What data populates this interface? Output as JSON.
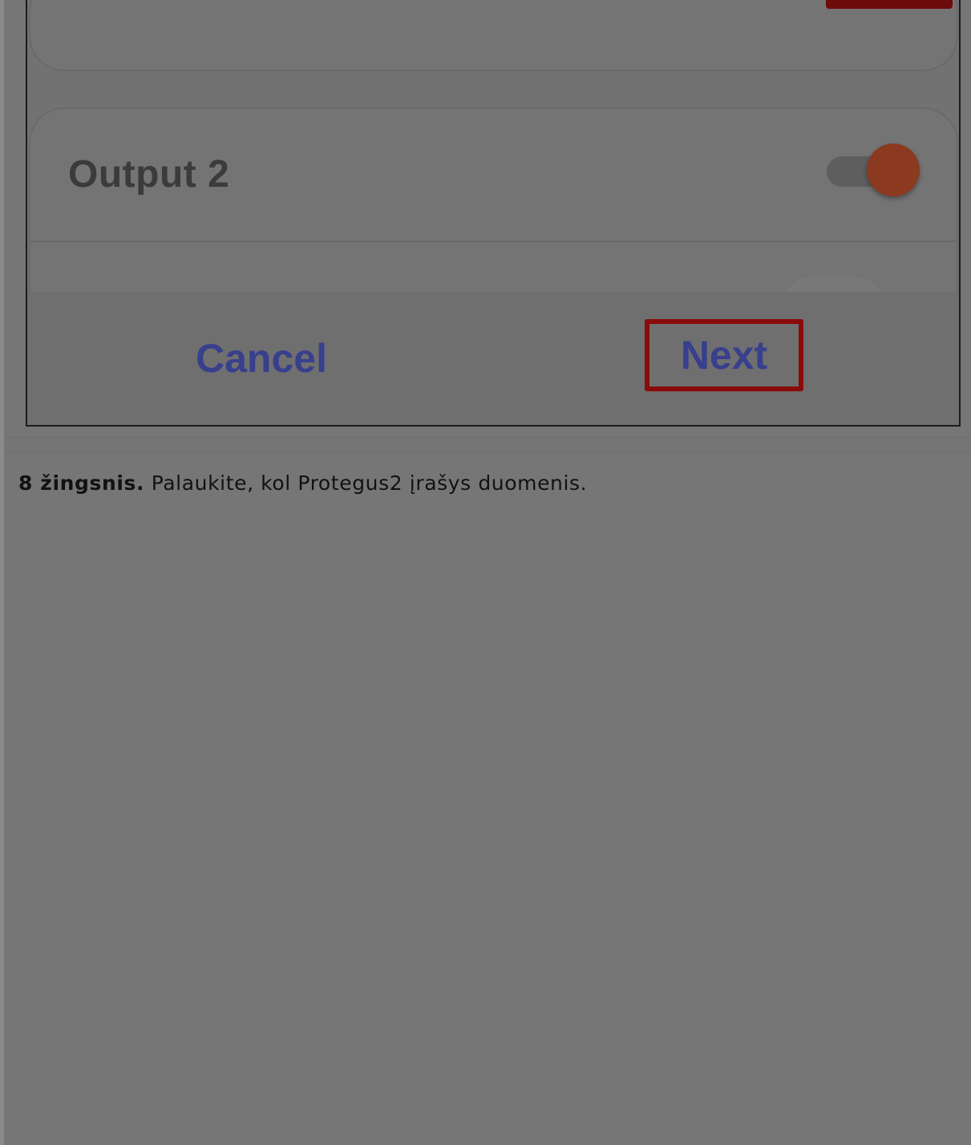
{
  "figure": {
    "output_label": "Output 2",
    "toggle_state": "on",
    "toggle_color": "#8b3a20",
    "cancel_label": "Cancel",
    "next_label": "Next",
    "highlight_color": "#8a0b0b",
    "button_color": "#383f8c"
  },
  "step": {
    "number_label": "8 žingsnis.",
    "instruction": "Palaukite, kol Protegus2 įrašys duomenis."
  }
}
